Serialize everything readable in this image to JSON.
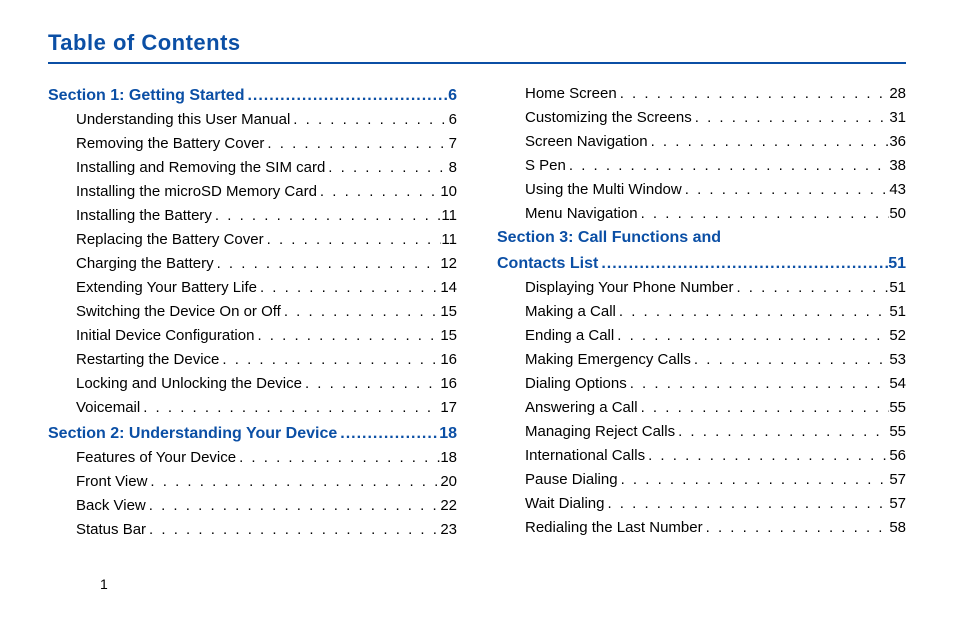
{
  "title": "Table of Contents",
  "pageNumber": "1",
  "columns": [
    [
      {
        "type": "section",
        "label": "Section 1:  Getting Started",
        "page": "6"
      },
      {
        "type": "item",
        "label": "Understanding this User Manual",
        "page": "6"
      },
      {
        "type": "item",
        "label": "Removing the Battery Cover",
        "page": "7"
      },
      {
        "type": "item",
        "label": "Installing and Removing the SIM card",
        "page": "8"
      },
      {
        "type": "item",
        "label": "Installing the microSD Memory Card",
        "page": "10"
      },
      {
        "type": "item",
        "label": "Installing the Battery",
        "page": "11"
      },
      {
        "type": "item",
        "label": "Replacing the Battery Cover",
        "page": "11"
      },
      {
        "type": "item",
        "label": "Charging the Battery",
        "page": "12"
      },
      {
        "type": "item",
        "label": "Extending Your Battery Life",
        "page": "14"
      },
      {
        "type": "item",
        "label": "Switching the Device On or Off",
        "page": "15"
      },
      {
        "type": "item",
        "label": "Initial Device Configuration",
        "page": "15"
      },
      {
        "type": "item",
        "label": "Restarting the Device",
        "page": "16"
      },
      {
        "type": "item",
        "label": "Locking and Unlocking the Device",
        "page": "16"
      },
      {
        "type": "item",
        "label": "Voicemail",
        "page": "17"
      },
      {
        "type": "section",
        "label": "Section 2:  Understanding Your Device",
        "page": "18"
      },
      {
        "type": "item",
        "label": "Features of Your Device",
        "page": "18"
      },
      {
        "type": "item",
        "label": "Front View",
        "page": "20"
      },
      {
        "type": "item",
        "label": "Back View",
        "page": "22"
      },
      {
        "type": "item",
        "label": "Status Bar",
        "page": "23"
      }
    ],
    [
      {
        "type": "item",
        "label": "Home Screen",
        "page": "28"
      },
      {
        "type": "item",
        "label": "Customizing the Screens",
        "page": "31"
      },
      {
        "type": "item",
        "label": "Screen Navigation",
        "page": "36"
      },
      {
        "type": "item",
        "label": "S Pen",
        "page": "38"
      },
      {
        "type": "item",
        "label": "Using the Multi Window",
        "page": "43"
      },
      {
        "type": "item",
        "label": "Menu Navigation",
        "page": "50"
      },
      {
        "type": "section-cont",
        "label": "Section 3:  Call Functions and"
      },
      {
        "type": "section",
        "label": "Contacts List",
        "page": "51"
      },
      {
        "type": "item",
        "label": "Displaying Your Phone Number",
        "page": "51"
      },
      {
        "type": "item",
        "label": "Making a Call",
        "page": "51"
      },
      {
        "type": "item",
        "label": "Ending a Call",
        "page": "52"
      },
      {
        "type": "item",
        "label": "Making Emergency Calls",
        "page": "53"
      },
      {
        "type": "item",
        "label": "Dialing Options",
        "page": "54"
      },
      {
        "type": "item",
        "label": "Answering a Call",
        "page": "55"
      },
      {
        "type": "item",
        "label": "Managing Reject Calls",
        "page": "55"
      },
      {
        "type": "item",
        "label": "International Calls",
        "page": "56"
      },
      {
        "type": "item",
        "label": "Pause Dialing",
        "page": "57"
      },
      {
        "type": "item",
        "label": "Wait Dialing",
        "page": "57"
      },
      {
        "type": "item",
        "label": "Redialing the Last Number",
        "page": "58"
      }
    ]
  ]
}
